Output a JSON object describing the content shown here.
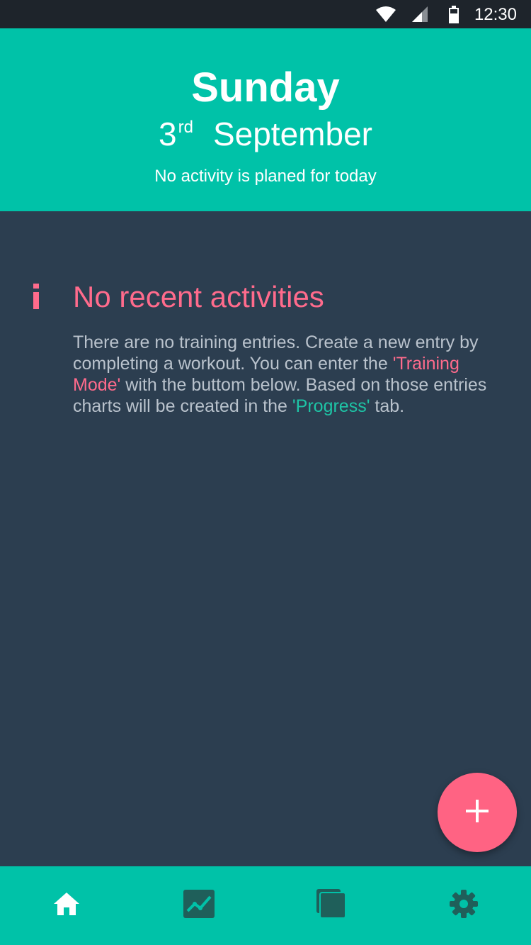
{
  "status_bar": {
    "time": "12:30",
    "icons": [
      "wifi-icon",
      "cell-signal-icon",
      "battery-icon"
    ]
  },
  "header": {
    "day": "Sunday",
    "date_number": "3",
    "date_suffix": "rd",
    "month": "September",
    "planned_text": "No activity is planed for today"
  },
  "info": {
    "icon": "info-icon",
    "title": "No recent activities",
    "text_1": "There are no training entries. Create a new entry by completing a workout. You can enter the ",
    "link_training": "'Training Mode'",
    "text_2": " with the buttom below. Based on those entries charts will be created in the ",
    "link_progress": "'Progress'",
    "text_3": " tab."
  },
  "fab": {
    "icon": "plus-icon"
  },
  "bottom_nav": {
    "items": [
      {
        "icon": "home-icon",
        "active": true
      },
      {
        "icon": "chart-icon",
        "active": false
      },
      {
        "icon": "pages-icon",
        "active": false
      },
      {
        "icon": "gear-icon",
        "active": false
      }
    ]
  },
  "colors": {
    "accent": "#00c2a8",
    "background": "#2c3e50",
    "pink": "#ff6383",
    "inactive_icon": "#1f5f5a"
  }
}
